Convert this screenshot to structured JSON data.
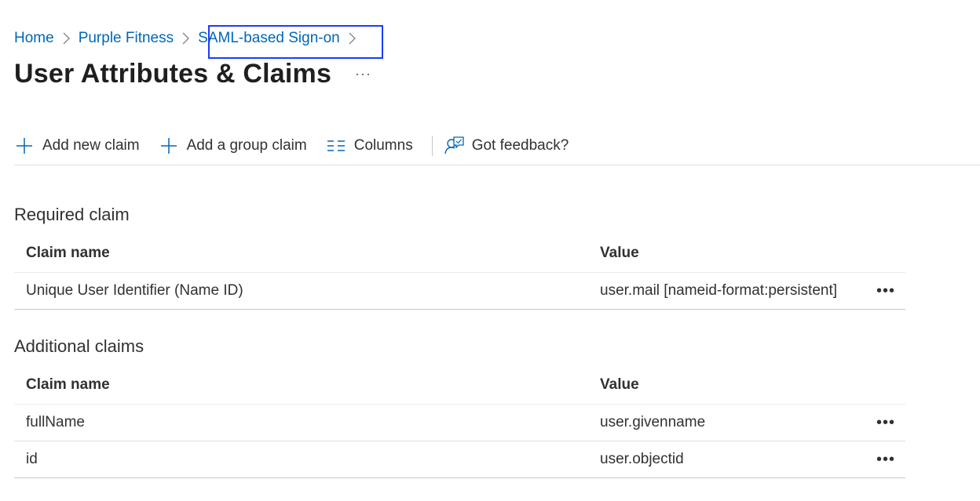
{
  "breadcrumb": {
    "items": [
      {
        "label": "Home"
      },
      {
        "label": "Purple Fitness"
      },
      {
        "label": "SAML-based Sign-on"
      }
    ]
  },
  "page": {
    "title": "User Attributes & Claims",
    "more_label": "···"
  },
  "toolbar": {
    "add_new_claim": "Add new claim",
    "add_group_claim": "Add a group claim",
    "columns": "Columns",
    "feedback": "Got feedback?"
  },
  "required_claim": {
    "title": "Required claim",
    "columns": {
      "name": "Claim name",
      "value": "Value"
    },
    "rows": [
      {
        "name": "Unique User Identifier (Name ID)",
        "value": "user.mail [nameid-format:persistent]",
        "more": "•••"
      }
    ]
  },
  "additional_claims": {
    "title": "Additional claims",
    "columns": {
      "name": "Claim name",
      "value": "Value"
    },
    "rows": [
      {
        "name": "fullName",
        "value": "user.givenname",
        "more": "•••"
      },
      {
        "name": "id",
        "value": "user.objectid",
        "more": "•••"
      }
    ]
  },
  "colors": {
    "link": "#0067b8",
    "highlight_box": "#1a3cff",
    "text": "#323130"
  }
}
